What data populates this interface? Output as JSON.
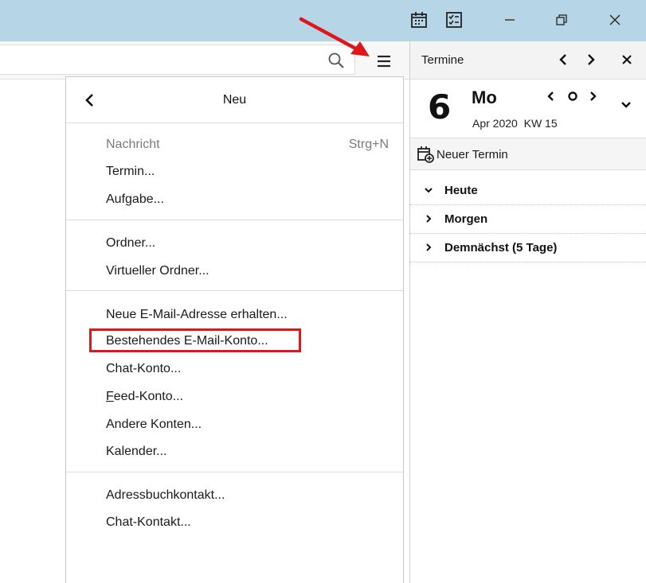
{
  "titlebar": {
    "icons": [
      "calendar-icon",
      "tasks-icon"
    ],
    "controls": [
      "minimize-icon",
      "restore-icon",
      "close-icon"
    ]
  },
  "search": {
    "placeholder": "",
    "icon": "search-icon"
  },
  "menu": {
    "title": "Neu",
    "groups": [
      [
        {
          "label": "Nachricht",
          "shortcut": "Strg+N",
          "disabled": true
        },
        {
          "label": "Termin..."
        },
        {
          "label": "Aufgabe..."
        }
      ],
      [
        {
          "label": "Ordner..."
        },
        {
          "label": "Virtueller Ordner..."
        }
      ],
      [
        {
          "label": "Neue E-Mail-Adresse erhalten..."
        },
        {
          "label": "Bestehendes E-Mail-Konto...",
          "highlighted": true
        },
        {
          "label": "Chat-Konto..."
        },
        {
          "label_access": "F",
          "label_rest": "eed-Konto..."
        },
        {
          "label": "Andere Konten..."
        },
        {
          "label": "Kalender..."
        }
      ],
      [
        {
          "label": "Adressbuchkontakt..."
        },
        {
          "label": "Chat-Kontakt..."
        }
      ]
    ]
  },
  "calendar": {
    "title": "Termine",
    "day_number": "6",
    "weekday": "Mo",
    "month_year": "Apr 2020",
    "week": "KW 15",
    "new_event_label": "Neuer Termin",
    "agenda": [
      {
        "label": "Heute",
        "expanded": true
      },
      {
        "label": "Morgen",
        "expanded": false
      },
      {
        "label": "Demnächst (5 Tage)",
        "expanded": false
      }
    ]
  },
  "colors": {
    "titlebar": "#b6d6e8",
    "highlight": "#e0161b",
    "arrow": "#e0161b"
  }
}
